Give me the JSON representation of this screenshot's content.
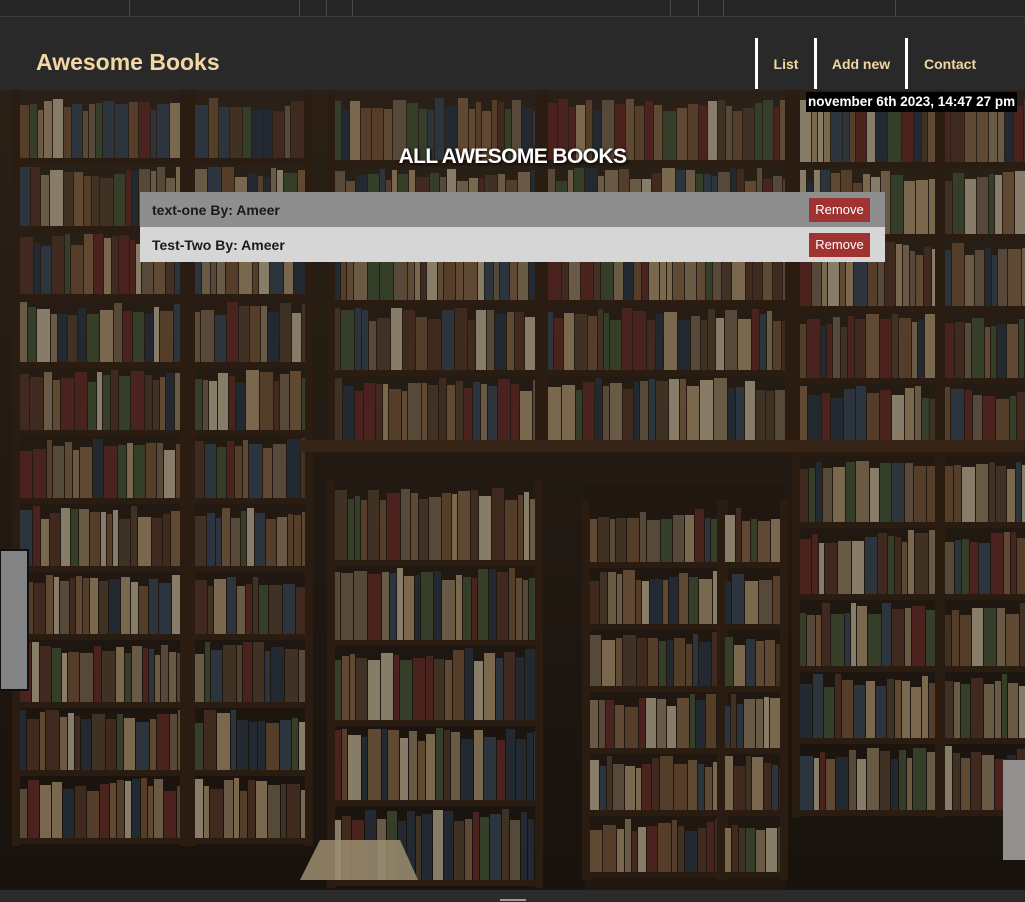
{
  "header": {
    "brand": "Awesome Books",
    "nav": [
      {
        "label": "List"
      },
      {
        "label": "Add new"
      },
      {
        "label": "Contact"
      }
    ]
  },
  "date_display": "november 6th 2023, 14:47 27 pm",
  "main": {
    "title": "ALL AWESOME BOOKS",
    "books": [
      {
        "text": "text-one By: Ameer",
        "remove_label": "Remove"
      },
      {
        "text": "Test-Two By: Ameer",
        "remove_label": "Remove"
      }
    ]
  },
  "colors": {
    "brand_text": "#f1d7a3",
    "header_bg": "#292929",
    "remove_button": "#a03232",
    "row_odd": "#8e8e8e",
    "row_even": "#d6d6d6"
  }
}
